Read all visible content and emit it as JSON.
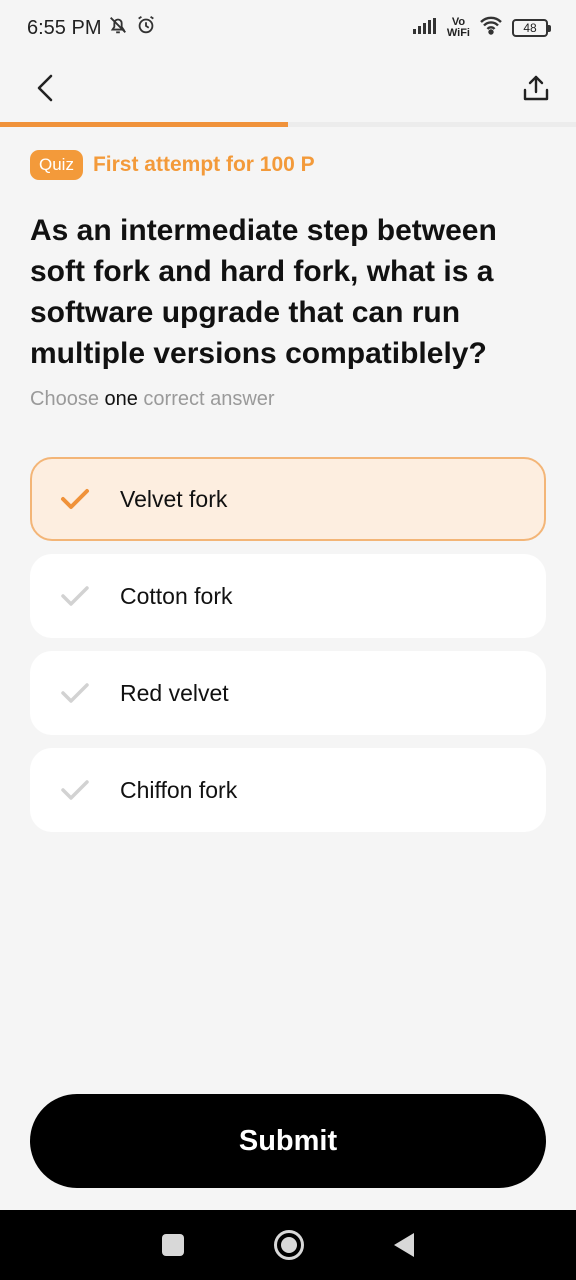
{
  "status_bar": {
    "time": "6:55 PM",
    "vowifi_top": "Vo",
    "vowifi_bottom": "WiFi",
    "battery": "48"
  },
  "progress": {
    "fraction": 0.5,
    "color": "#f0923a"
  },
  "quiz": {
    "badge": "Quiz",
    "attempt_text": "First attempt for 100 P"
  },
  "question": "As an intermediate step between soft fork and hard fork, what is a software upgrade that can run multiple versions compatiblely?",
  "instruction": {
    "prefix": "Choose ",
    "emphasis": "one",
    "suffix": " correct answer"
  },
  "options": [
    {
      "label": "Velvet fork",
      "selected": true
    },
    {
      "label": "Cotton fork",
      "selected": false
    },
    {
      "label": "Red velvet",
      "selected": false
    },
    {
      "label": "Chiffon fork",
      "selected": false
    }
  ],
  "submit_label": "Submit",
  "colors": {
    "accent": "#f39a3a",
    "selected_bg": "#fdeee0",
    "background": "#f5f5f5"
  },
  "icons": [
    "back-arrow-icon",
    "share-icon",
    "check-icon",
    "mute-bell-icon",
    "alarm-icon",
    "signal-icon",
    "wifi-icon",
    "battery-icon"
  ]
}
